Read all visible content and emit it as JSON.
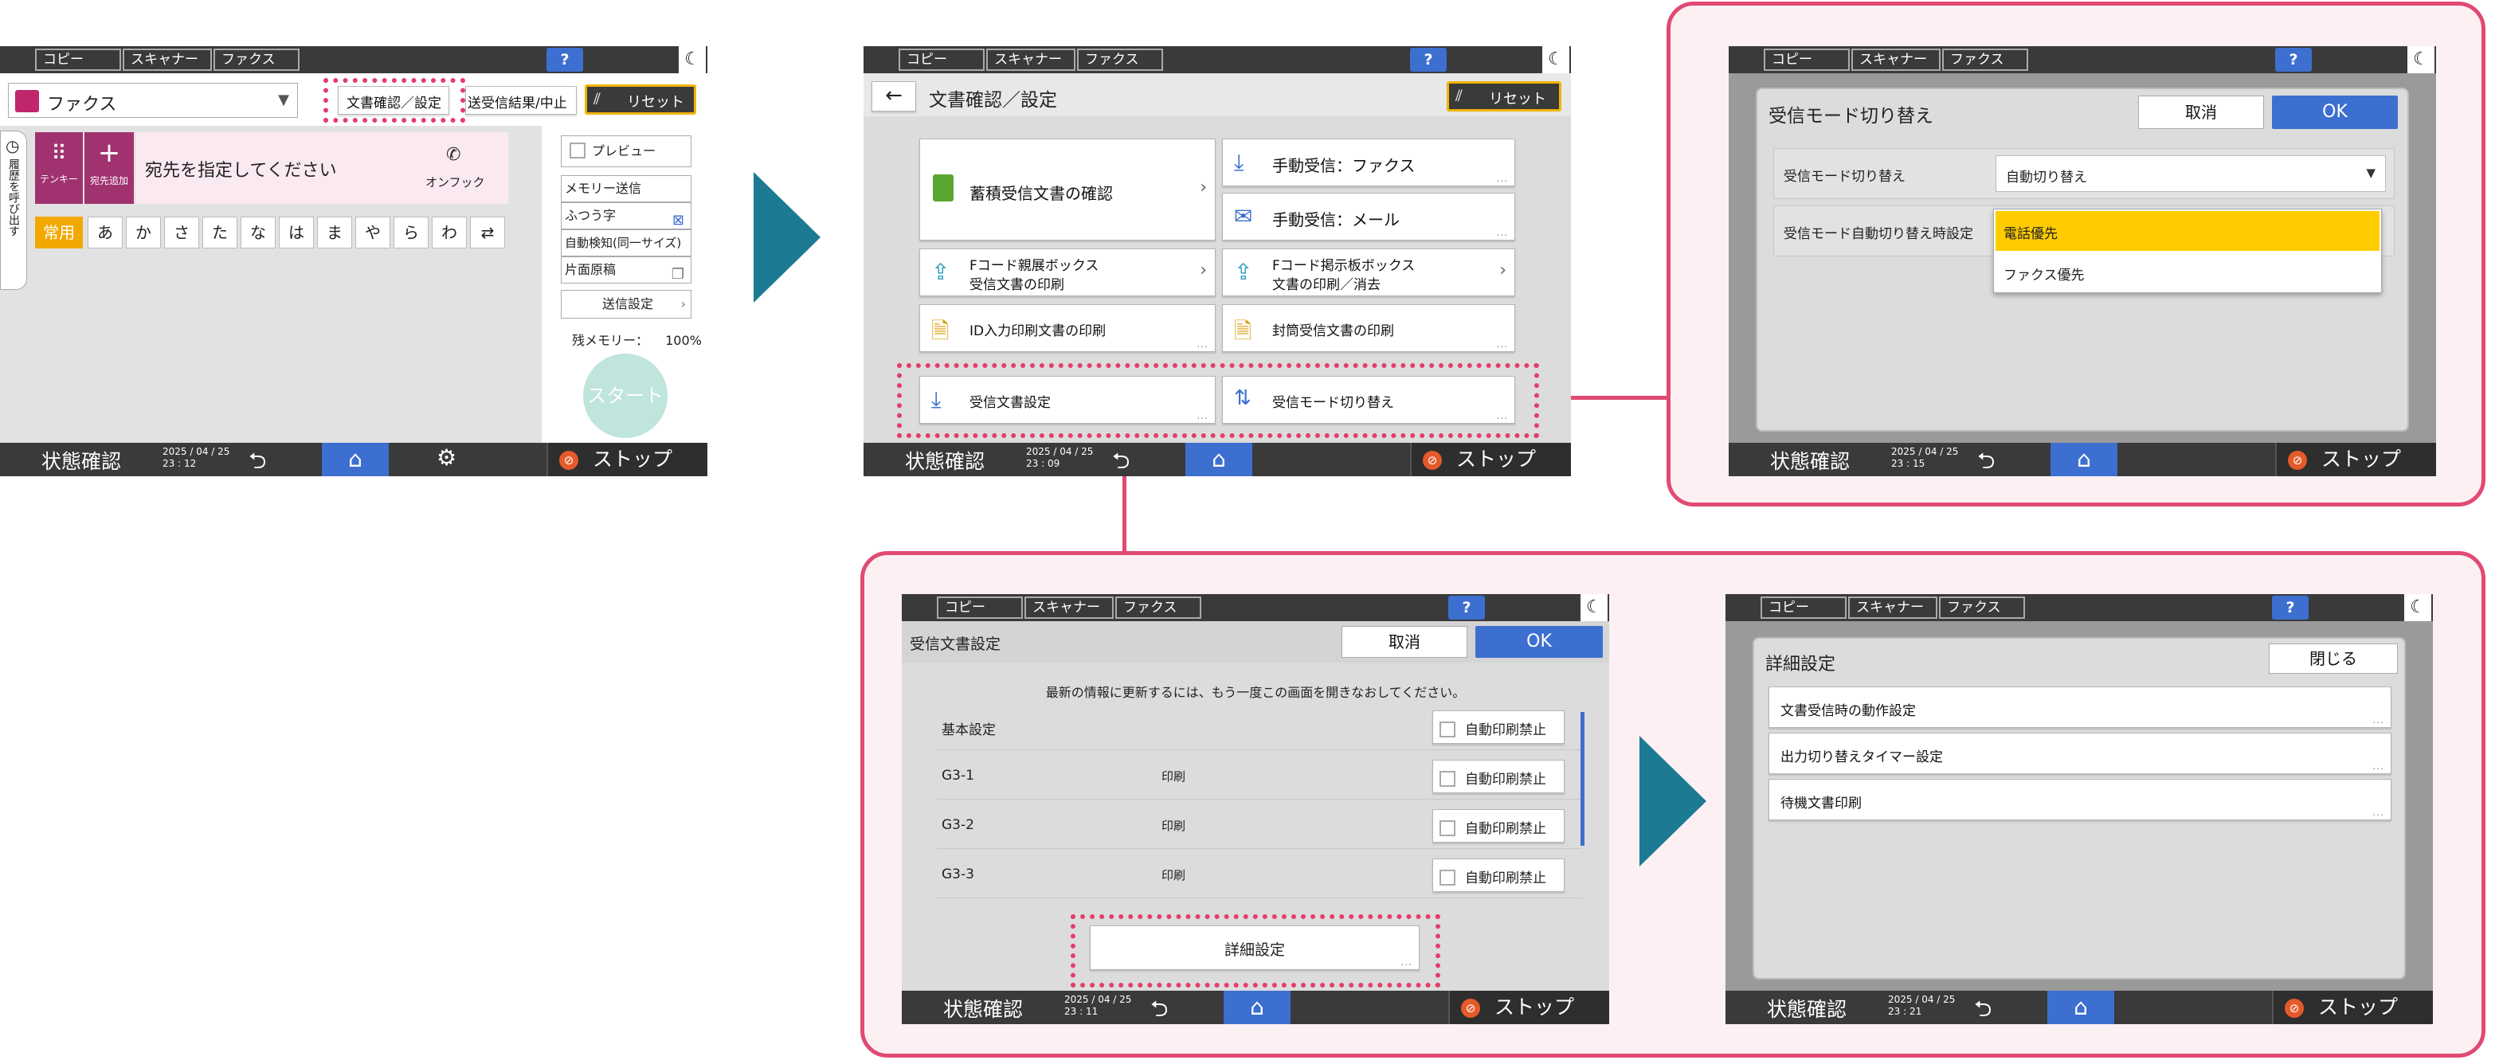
{
  "common": {
    "tabs": [
      "コピー",
      "スキャナー",
      "ファクス"
    ],
    "help": "?",
    "moon": "☾",
    "status": "状態確認",
    "stop": "ストップ",
    "stop_icon": "⊘",
    "back_icon": "⮌",
    "home_icon": "⌂",
    "gear_icon": "⚙"
  },
  "screen1": {
    "app_select": "ファクス",
    "doc_confirm_btn": "文書確認／設定",
    "result_btn": "送受信結果/中止",
    "reset_btn": "リセット",
    "side_tab": "履歴を呼び出す",
    "tenkey": "テンキー",
    "add_dest": "宛先追加",
    "dest_prompt": "宛先を指定してください",
    "onhook": "オンフック",
    "kana": [
      "常用",
      "あ",
      "か",
      "さ",
      "た",
      "な",
      "は",
      "ま",
      "や",
      "ら",
      "わ",
      "⇄"
    ],
    "preview": "プレビュー",
    "memory_send": "メモリー送信",
    "normal_char": "ふつう字",
    "auto_detect": "自動検知(同一サイズ)",
    "one_side": "片面原稿",
    "send_settings": "送信設定",
    "remaining_label": "残メモリー：",
    "remaining_value": "100%",
    "start": "スタート",
    "date": "2025 / 04 / 25",
    "time": "23 : 12"
  },
  "screen2": {
    "title": "文書確認／設定",
    "reset_btn": "リセット",
    "stored_docs": "蓄積受信文書の確認",
    "manual_fax": "手動受信：ファクス",
    "manual_mail": "手動受信：メール",
    "fcode_personal_1": "Fコード親展ボックス",
    "fcode_personal_2": "受信文書の印刷",
    "fcode_board_1": "Fコード掲示板ボックス",
    "fcode_board_2": "文書の印刷／消去",
    "id_print": "ID入力印刷文書の印刷",
    "sealed_print": "封筒受信文書の印刷",
    "recv_doc_settings": "受信文書設定",
    "recv_mode_switch": "受信モード切り替え",
    "date": "2025 / 04 / 25",
    "time": "23 : 09"
  },
  "screen3": {
    "dialog_title": "受信モード切り替え",
    "cancel": "取消",
    "ok": "OK",
    "row1_label": "受信モード切り替え",
    "row1_value": "自動切り替え",
    "row2_label": "受信モード自動切り替え時設定",
    "options": [
      "電話優先",
      "ファクス優先"
    ],
    "date": "2025 / 04 / 25",
    "time": "23 : 15"
  },
  "screen4": {
    "title": "受信文書設定",
    "cancel": "取消",
    "ok": "OK",
    "notice": "最新の情報に更新するには、もう一度この画面を開きなおしてください。",
    "rows": [
      {
        "name": "基本設定",
        "value": "",
        "check": "自動印刷禁止"
      },
      {
        "name": "G3-1",
        "value": "印刷",
        "check": "自動印刷禁止"
      },
      {
        "name": "G3-2",
        "value": "印刷",
        "check": "自動印刷禁止"
      },
      {
        "name": "G3-3",
        "value": "印刷",
        "check": "自動印刷禁止"
      }
    ],
    "detail_btn": "詳細設定",
    "date": "2025 / 04 / 25",
    "time": "23 : 11"
  },
  "screen5": {
    "title": "詳細設定",
    "close": "閉じる",
    "items": [
      "文書受信時の動作設定",
      "出力切り替えタイマー設定",
      "待機文書印刷"
    ],
    "date": "2025 / 04 / 25",
    "time": "23 : 21"
  },
  "colors": {
    "highlight": "#e53d6b",
    "panel_border": "#e04a73",
    "panel_bg": "#fdf0f3",
    "arrow": "#1d7a93",
    "accent_blue": "#3d6fd0",
    "option_selected": "#ffcc00"
  }
}
